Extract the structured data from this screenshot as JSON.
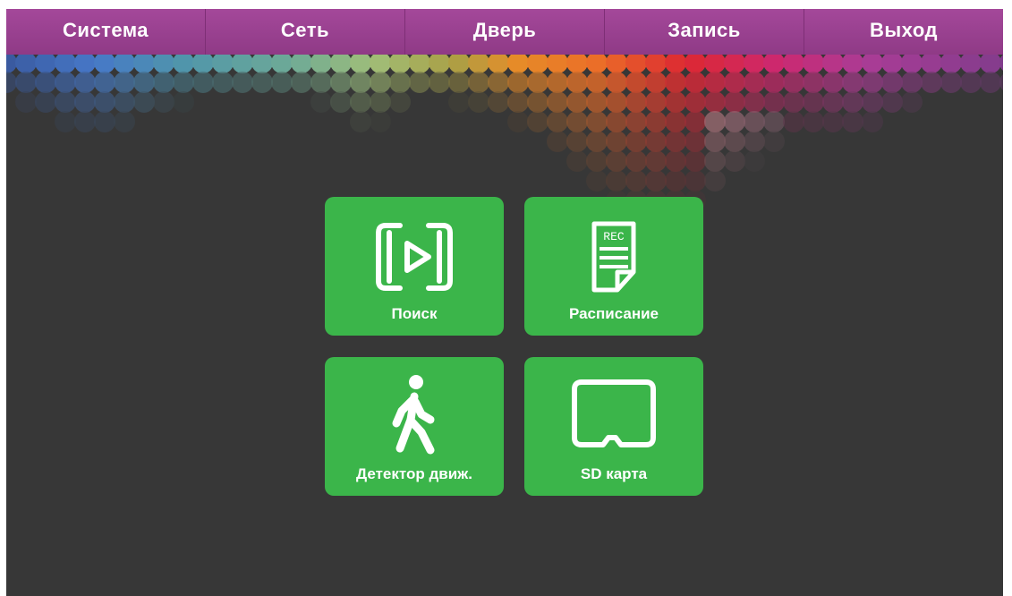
{
  "menu": {
    "tabs": [
      {
        "label": "Система"
      },
      {
        "label": "Сеть"
      },
      {
        "label": "Дверь"
      },
      {
        "label": "Запись"
      },
      {
        "label": "Выход"
      }
    ]
  },
  "tiles": {
    "search": {
      "label": "Поиск",
      "icon": "play-frame-icon"
    },
    "schedule": {
      "label": "Расписание",
      "icon": "rec-document-icon",
      "icon_text": "REC"
    },
    "motion": {
      "label": "Детектор движ.",
      "icon": "walking-person-icon"
    },
    "sd": {
      "label": "SD карта",
      "icon": "sd-card-icon"
    }
  },
  "colors": {
    "menu_bar": "#9a3f90",
    "screen_bg": "#373737",
    "tile_bg": "#3bb54a",
    "text": "#ffffff"
  }
}
